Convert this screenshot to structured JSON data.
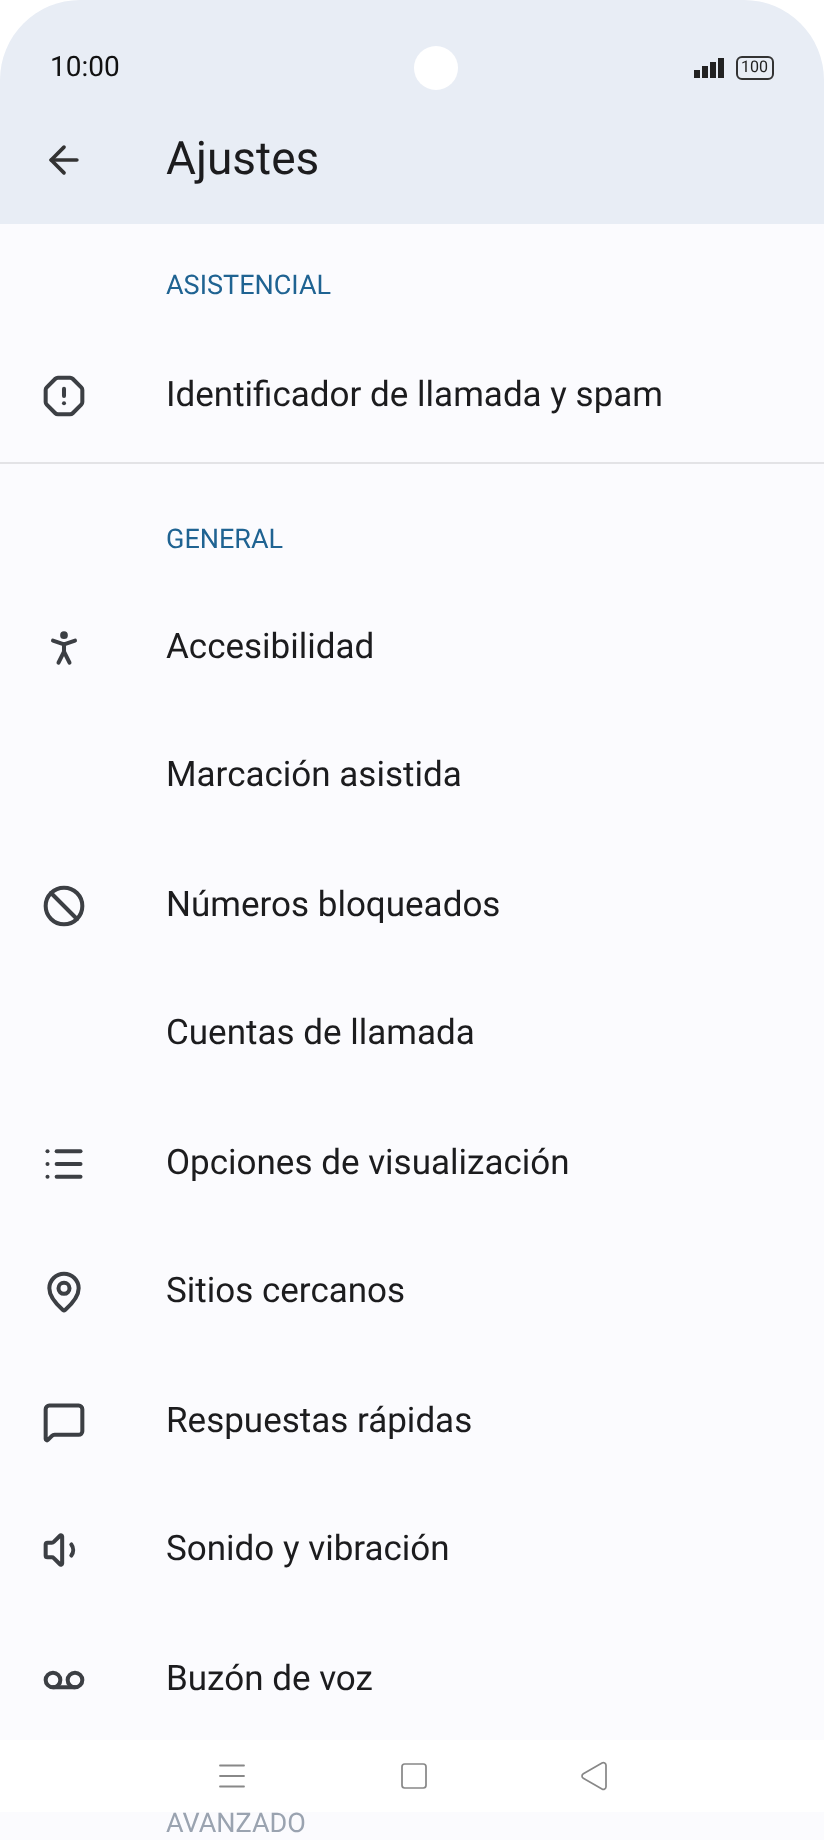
{
  "status_bar": {
    "time": "10:00",
    "battery": "100"
  },
  "header": {
    "title": "Ajustes"
  },
  "sections": [
    {
      "title": "ASISTENCIAL",
      "items": [
        {
          "label": "Identificador de llamada y spam"
        }
      ]
    },
    {
      "title": "GENERAL",
      "items": [
        {
          "label": "Accesibilidad"
        },
        {
          "label": "Marcación asistida"
        },
        {
          "label": "Números bloqueados"
        },
        {
          "label": "Cuentas de llamada"
        },
        {
          "label": "Opciones de visualización"
        },
        {
          "label": "Sitios cercanos"
        },
        {
          "label": "Respuestas rápidas"
        },
        {
          "label": "Sonido y vibración"
        },
        {
          "label": "Buzón de voz"
        }
      ]
    },
    {
      "title": "AVANZADO"
    }
  ]
}
